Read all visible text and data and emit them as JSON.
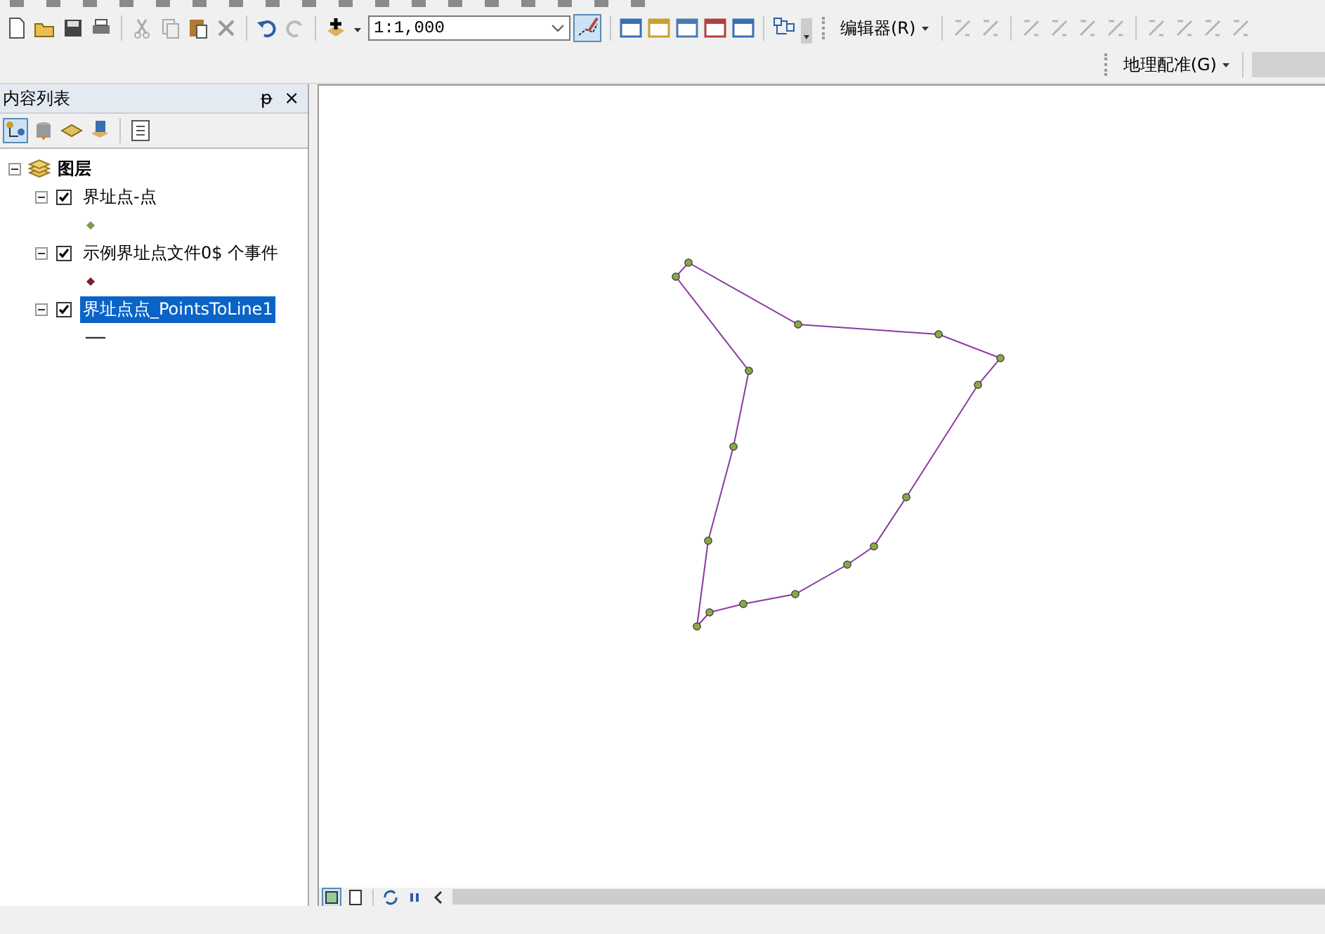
{
  "toolbar": {
    "scale_field": {
      "value": "1:1,000"
    },
    "menus": [
      {
        "label": "编辑器(R)"
      }
    ]
  },
  "toolbar_row_2": {
    "menus": [
      {
        "label": "地理配准(G)"
      }
    ]
  },
  "toc": {
    "title": "内容列表",
    "pin": "ᵽ",
    "close": "×",
    "tree": {
      "label": "图层",
      "expanded": true,
      "children": [
        {
          "label": "界址点-点",
          "checked": true,
          "expanded": true,
          "selected": false,
          "symbol": {
            "kind": "point",
            "color": "#7c9a4a"
          }
        },
        {
          "label": "示例界址点文件0$ 个事件",
          "checked": true,
          "expanded": true,
          "selected": false,
          "symbol": {
            "kind": "point",
            "color": "#7a1f2b"
          }
        },
        {
          "label": "界址点点_PointsToLine1",
          "checked": true,
          "expanded": true,
          "selected": true,
          "symbol": {
            "kind": "line",
            "color": "#333333"
          }
        }
      ]
    }
  }
}
